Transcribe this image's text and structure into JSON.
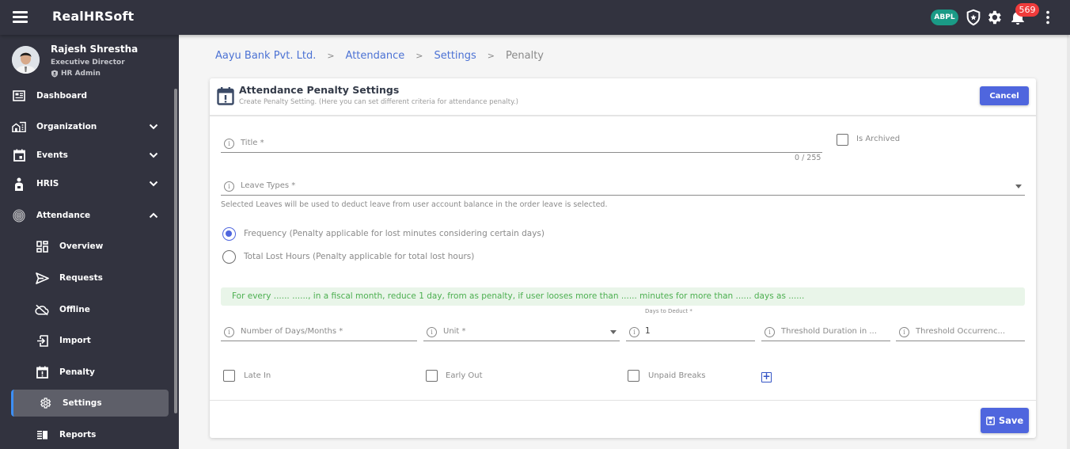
{
  "app": {
    "title": "RealHRSoft"
  },
  "topbar": {
    "org_badge": "ABPL",
    "notification_count": "569",
    "colors": {
      "bar": "#32333f",
      "org_badge": "#1a9a86",
      "notification_badge": "#ef3b3b"
    }
  },
  "user": {
    "name": "Rajesh Shrestha",
    "role": "Executive Director",
    "permission": "HR Admin"
  },
  "sidebar": {
    "items": [
      {
        "label": "Dashboard",
        "icon": "dashboard-icon"
      },
      {
        "label": "Organization",
        "icon": "organization-icon",
        "expandable": true,
        "expanded": false
      },
      {
        "label": "Events",
        "icon": "calendar-icon",
        "expandable": true,
        "expanded": false
      },
      {
        "label": "HRIS",
        "icon": "person-badge-icon",
        "expandable": true,
        "expanded": false
      },
      {
        "label": "Attendance",
        "icon": "fingerprint-icon",
        "expandable": true,
        "expanded": true
      }
    ],
    "attendance_sub": [
      {
        "label": "Overview",
        "icon": "grid-icon"
      },
      {
        "label": "Requests",
        "icon": "send-icon"
      },
      {
        "label": "Offline",
        "icon": "cloud-off-icon"
      },
      {
        "label": "Import",
        "icon": "import-icon"
      },
      {
        "label": "Penalty",
        "icon": "calendar-alert-icon"
      },
      {
        "label": "Settings",
        "icon": "gear-icon",
        "active": true
      },
      {
        "label": "Reports",
        "icon": "reports-icon"
      }
    ]
  },
  "breadcrumb": {
    "items": [
      "Aayu Bank Pvt. Ltd.",
      "Attendance",
      "Settings"
    ],
    "current": "Penalty",
    "separator": ">"
  },
  "card": {
    "title": "Attendance Penalty Settings",
    "subtitle": "Create Penalty Setting. (Here you can set different criteria for attendance penalty.)",
    "cancel_label": "Cancel",
    "save_label": "Save"
  },
  "form": {
    "title": {
      "placeholder": "Title *",
      "value": "",
      "counter": "0 / 255"
    },
    "is_archived": {
      "label": "Is Archived",
      "checked": false
    },
    "leave_types": {
      "placeholder": "Leave Types *",
      "hint": "Selected Leaves will be used to deduct leave from user account balance in the order leave is selected."
    },
    "penalty_type": {
      "options": [
        {
          "label": "Frequency (Penalty applicable for lost minutes considering certain days)",
          "checked": true
        },
        {
          "label": "Total Lost Hours (Penalty applicable for total lost hours)",
          "checked": false
        }
      ]
    },
    "summary": "For every ...... ......, in a fiscal month, reduce 1 day, from as penalty, if user looses more than ...... minutes for more than ...... days as ......",
    "rule": {
      "number_of_days": {
        "placeholder": "Number of Days/Months *",
        "value": ""
      },
      "unit": {
        "placeholder": "Unit *",
        "value": ""
      },
      "days_to_deduct": {
        "label": "Days to Deduct *",
        "value": "1"
      },
      "threshold_duration": {
        "placeholder": "Threshold Duration in ...",
        "value": ""
      },
      "threshold_occurrence": {
        "placeholder": "Threshold Occurrenc...",
        "value": ""
      },
      "late_in": {
        "label": "Late In",
        "checked": false
      },
      "early_out": {
        "label": "Early Out",
        "checked": false
      },
      "unpaid_breaks": {
        "label": "Unpaid Breaks",
        "checked": false
      }
    }
  },
  "colors": {
    "primary": "#4f66de",
    "link": "#4c72d4",
    "summary_bg": "#e9f5e9",
    "summary_text": "#4caf50",
    "active_indicator": "#3d8ff5"
  }
}
